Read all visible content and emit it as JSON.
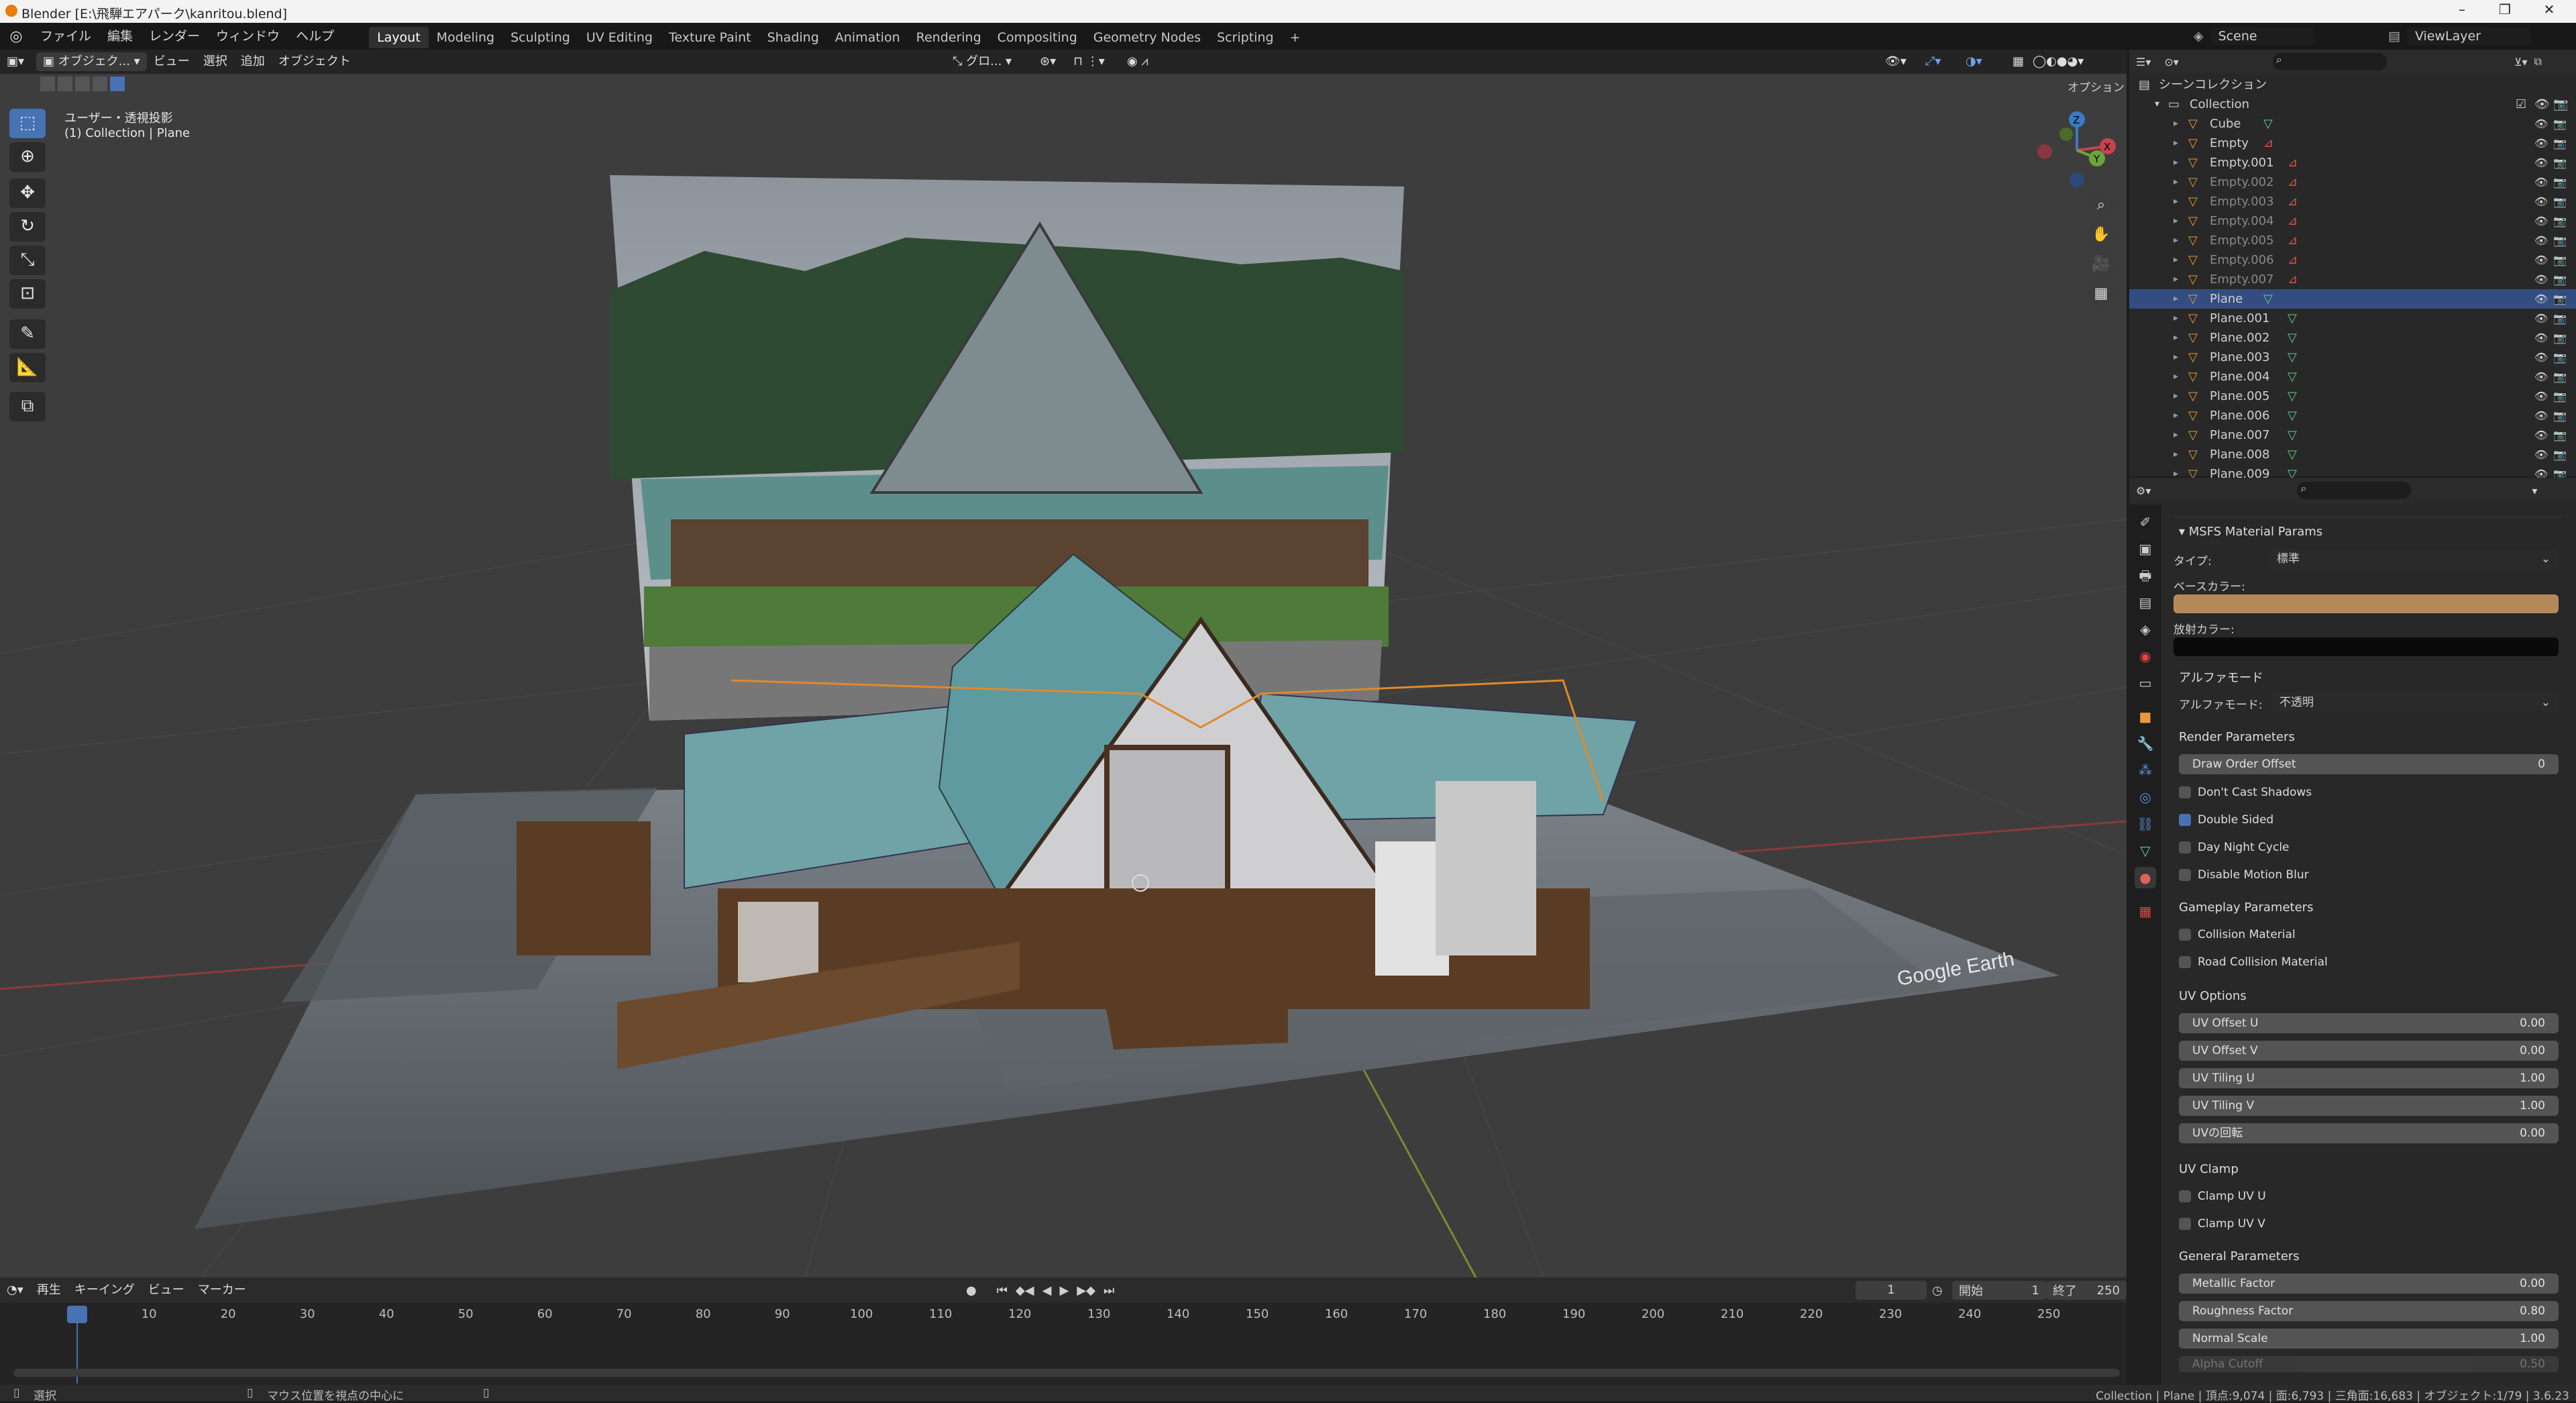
{
  "window": {
    "title": "Blender [E:\\飛騨エアパーク\\kanritou.blend]"
  },
  "menu": [
    "ファイル",
    "編集",
    "レンダー",
    "ウィンドウ",
    "ヘルプ"
  ],
  "workspaces": [
    "Layout",
    "Modeling",
    "Sculpting",
    "UV Editing",
    "Texture Paint",
    "Shading",
    "Animation",
    "Rendering",
    "Compositing",
    "Geometry Nodes",
    "Scripting"
  ],
  "active_workspace": "Layout",
  "scene": {
    "name": "Scene",
    "view_layer": "ViewLayer"
  },
  "viewport": {
    "mode": "オブジェク...",
    "menus": [
      "ビュー",
      "選択",
      "追加",
      "オブジェクト"
    ],
    "transform_orientation": "グロ...",
    "options_label": "オプション",
    "overlay_line1": "ユーザー・透視投影",
    "overlay_line2": "(1) Collection | Plane",
    "watermark": "Google Earth",
    "gizmo": {
      "z": "Z",
      "y": "Y",
      "x": "X"
    }
  },
  "outliner": {
    "scene_collection": "シーンコレクション",
    "collection": "Collection",
    "items": [
      {
        "name": "Cube",
        "type": "mesh",
        "selected": false
      },
      {
        "name": "Empty",
        "type": "empty",
        "selected": false
      },
      {
        "name": "Empty.001",
        "type": "empty",
        "selected": false
      },
      {
        "name": "Empty.002",
        "type": "empty",
        "selected": false
      },
      {
        "name": "Empty.003",
        "type": "empty",
        "selected": false
      },
      {
        "name": "Empty.004",
        "type": "empty",
        "selected": false
      },
      {
        "name": "Empty.005",
        "type": "empty",
        "selected": false
      },
      {
        "name": "Empty.006",
        "type": "empty",
        "selected": false
      },
      {
        "name": "Empty.007",
        "type": "empty",
        "selected": false
      },
      {
        "name": "Plane",
        "type": "mesh",
        "selected": true
      },
      {
        "name": "Plane.001",
        "type": "mesh",
        "selected": false
      },
      {
        "name": "Plane.002",
        "type": "mesh",
        "selected": false
      },
      {
        "name": "Plane.003",
        "type": "mesh",
        "selected": false
      },
      {
        "name": "Plane.004",
        "type": "mesh",
        "selected": false
      },
      {
        "name": "Plane.005",
        "type": "mesh",
        "selected": false
      },
      {
        "name": "Plane.006",
        "type": "mesh",
        "selected": false
      },
      {
        "name": "Plane.007",
        "type": "mesh",
        "selected": false
      },
      {
        "name": "Plane.008",
        "type": "mesh",
        "selected": false
      },
      {
        "name": "Plane.009",
        "type": "mesh",
        "selected": false
      }
    ]
  },
  "properties": {
    "panel_title": "MSFS Material Params",
    "type_label": "タイプ:",
    "type_value": "標準",
    "base_color_label": "ベースカラー:",
    "base_color": "#b4895a",
    "emissive_label": "放射カラー:",
    "emissive_color": "#0a0a0a",
    "alpha_section": "アルファモード",
    "alpha_label": "アルファモード:",
    "alpha_value": "不透明",
    "render_params": "Render Parameters",
    "draw_order_label": "Draw Order Offset",
    "draw_order_value": "0",
    "dont_cast_shadows": "Don't Cast Shadows",
    "double_sided": "Double Sided",
    "day_night_cycle": "Day Night Cycle",
    "disable_motion_blur": "Disable Motion Blur",
    "gameplay_params": "Gameplay Parameters",
    "collision_material": "Collision Material",
    "road_collision_material": "Road Collision Material",
    "uv_options": "UV Options",
    "uv_fields": [
      {
        "label": "UV Offset U",
        "value": "0.00"
      },
      {
        "label": "UV Offset V",
        "value": "0.00"
      },
      {
        "label": "UV Tiling U",
        "value": "1.00"
      },
      {
        "label": "UV Tiling V",
        "value": "1.00"
      },
      {
        "label": "UVの回転",
        "value": "0.00"
      }
    ],
    "uv_clamp": "UV Clamp",
    "clamp_u": "Clamp UV U",
    "clamp_v": "Clamp UV V",
    "general_params": "General Parameters",
    "general_fields": [
      {
        "label": "Metallic Factor",
        "value": "0.00"
      },
      {
        "label": "Roughness Factor",
        "value": "0.80"
      },
      {
        "label": "Normal Scale",
        "value": "1.00"
      },
      {
        "label": "Alpha Cutoff",
        "value": "0.50"
      }
    ]
  },
  "timeline": {
    "menus": [
      "再生",
      "キーイング",
      "ビュー",
      "マーカー"
    ],
    "current_frame": "1",
    "start_label": "開始",
    "start": "1",
    "end_label": "終了",
    "end": "250",
    "frames": [
      "1",
      "10",
      "20",
      "30",
      "40",
      "50",
      "60",
      "70",
      "80",
      "90",
      "100",
      "110",
      "120",
      "130",
      "140",
      "150",
      "160",
      "170",
      "180",
      "190",
      "200",
      "210",
      "220",
      "230",
      "240",
      "250"
    ]
  },
  "status": {
    "left": "選択",
    "middle": "マウス位置を視点の中心に",
    "right": "Collection | Plane | 頂点:9,074 | 面:6,793 | 三角面:16,683 | オブジェクト:1/79 | 3.6.23"
  }
}
